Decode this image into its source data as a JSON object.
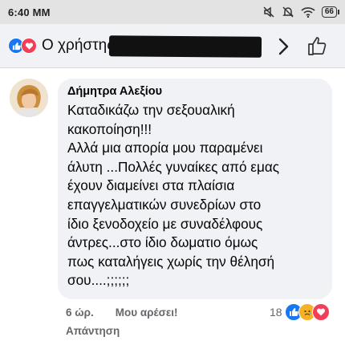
{
  "status_bar": {
    "time": "6:40 MM",
    "battery": "66"
  },
  "header": {
    "title": "Ο χρήστης",
    "icons": [
      "like-reaction-icon",
      "love-reaction-icon",
      "chevron-right-icon",
      "thumbs-up-icon"
    ]
  },
  "comment": {
    "author": "Δήμητρα Αλεξίου",
    "text": "Καταδικάζω την σεξουαλική\nκακοποίηση!!!\nΑλλά μια απορία μου παραμένει\nάλυτη ...Πολλές γυναίκες από εμας\nέχουν διαμείνει στα πλαίσια\nεπαγγελματικών συνεδρίων στο\nίδιο ξενοδοχείο με συναδέλφους\nάντρες...στο ίδιο δωματιο όμως\nπως καταλήγεις χωρίς την θέλησή\nσου....;;;;;;",
    "time": "6 ώρ.",
    "like_label": "Μου αρέσει!",
    "reply_label": "Απάντηση",
    "reaction_count": "18",
    "reactions": [
      "like",
      "sad",
      "love"
    ]
  },
  "colors": {
    "like_blue": "#1877f2",
    "love_red": "#f33e58",
    "sad_yellow": "#f7b125",
    "bubble_bg": "#f0f2f5",
    "meta_gray": "#65676b"
  }
}
